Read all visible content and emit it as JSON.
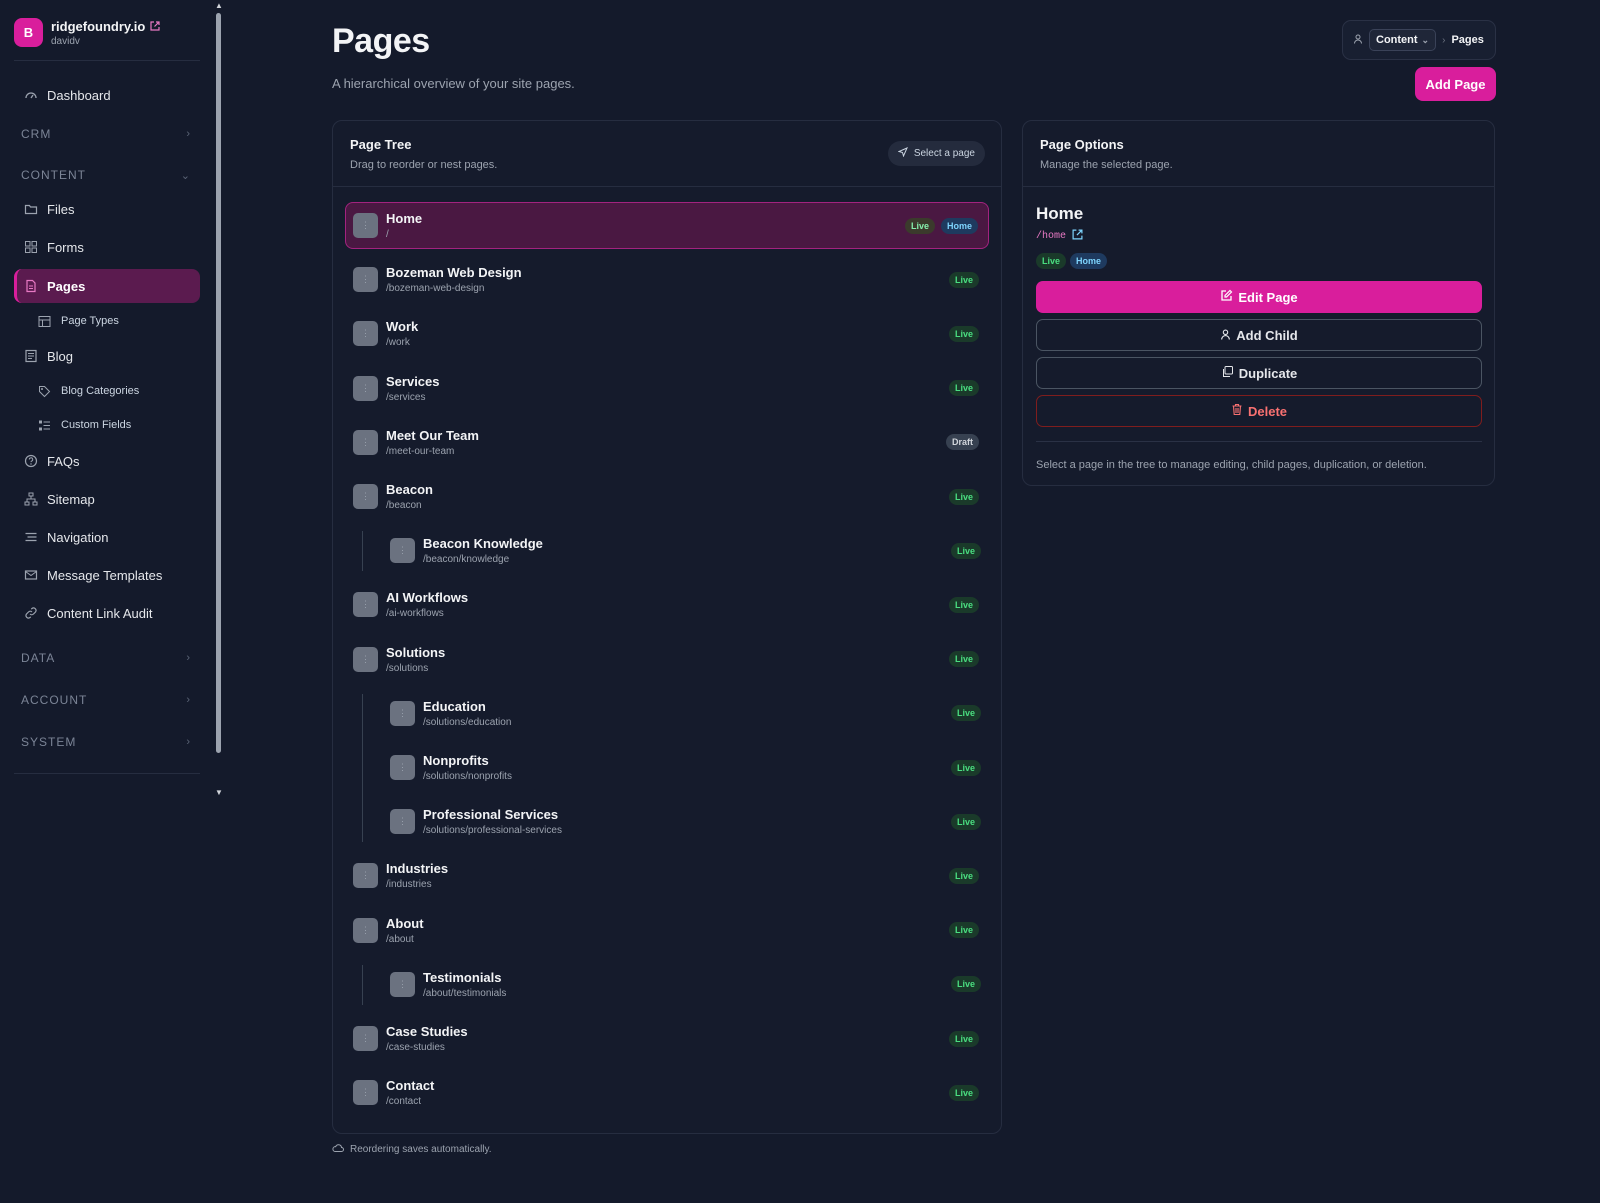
{
  "brand": {
    "initial": "B",
    "name": "ridgefoundry.io",
    "user": "davidv"
  },
  "sidebar": {
    "dashboard": "Dashboard",
    "crm": "CRM",
    "content": "CONTENT",
    "files": "Files",
    "forms": "Forms",
    "pages": "Pages",
    "page_types": "Page Types",
    "blog": "Blog",
    "blog_categories": "Blog Categories",
    "custom_fields": "Custom Fields",
    "faqs": "FAQs",
    "sitemap": "Sitemap",
    "navigation": "Navigation",
    "message_templates": "Message Templates",
    "content_link_audit": "Content Link Audit",
    "data": "DATA",
    "account": "ACCOUNT",
    "system": "SYSTEM"
  },
  "header": {
    "title": "Pages",
    "subtitle": "A hierarchical overview of your site pages.",
    "breadcrumb_section": "Content",
    "breadcrumb_current": "Pages",
    "add_page": "Add Page"
  },
  "tree": {
    "title": "Page Tree",
    "description": "Drag to reorder or nest pages.",
    "select_hint": "Select a page",
    "rows": [
      {
        "title": "Home",
        "slug": "/",
        "status": "Live",
        "home": "Home"
      },
      {
        "title": "Bozeman Web Design",
        "slug": "/bozeman-web-design",
        "status": "Live"
      },
      {
        "title": "Work",
        "slug": "/work",
        "status": "Live"
      },
      {
        "title": "Services",
        "slug": "/services",
        "status": "Live"
      },
      {
        "title": "Meet Our Team",
        "slug": "/meet-our-team",
        "status": "Draft"
      },
      {
        "title": "Beacon",
        "slug": "/beacon",
        "status": "Live"
      },
      {
        "title": "Beacon Knowledge",
        "slug": "/beacon/knowledge",
        "status": "Live"
      },
      {
        "title": "AI Workflows",
        "slug": "/ai-workflows",
        "status": "Live"
      },
      {
        "title": "Solutions",
        "slug": "/solutions",
        "status": "Live"
      },
      {
        "title": "Education",
        "slug": "/solutions/education",
        "status": "Live"
      },
      {
        "title": "Nonprofits",
        "slug": "/solutions/nonprofits",
        "status": "Live"
      },
      {
        "title": "Professional Services",
        "slug": "/solutions/professional-services",
        "status": "Live"
      },
      {
        "title": "Industries",
        "slug": "/industries",
        "status": "Live"
      },
      {
        "title": "About",
        "slug": "/about",
        "status": "Live"
      },
      {
        "title": "Testimonials",
        "slug": "/about/testimonials",
        "status": "Live"
      },
      {
        "title": "Case Studies",
        "slug": "/case-studies",
        "status": "Live"
      },
      {
        "title": "Contact",
        "slug": "/contact",
        "status": "Live"
      }
    ],
    "autosave_note": "Reordering saves automatically."
  },
  "options": {
    "title": "Page Options",
    "description": "Manage the selected page.",
    "page_title": "Home",
    "page_slug": "/home",
    "status": "Live",
    "home": "Home",
    "edit": "Edit Page",
    "add_child": "Add Child",
    "duplicate": "Duplicate",
    "delete": "Delete",
    "help": "Select a page in the tree to manage editing, child pages, duplication, or deletion."
  },
  "colors": {
    "accent": "#d91e9c",
    "background": "#141a2b",
    "live": "#4ade80",
    "home": "#7dd3fc",
    "danger": "#f87171"
  }
}
